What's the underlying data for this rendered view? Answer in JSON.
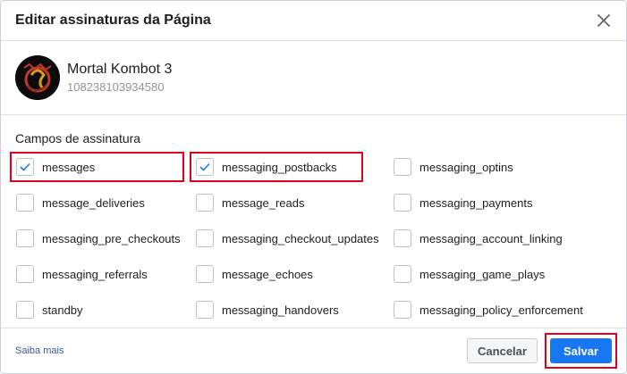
{
  "dialog": {
    "title": "Editar assinaturas da Página"
  },
  "page": {
    "name": "Mortal Kombot 3",
    "id": "108238103934580"
  },
  "subscription_fields": {
    "label": "Campos de assinatura",
    "items": [
      {
        "label": "messages",
        "checked": true,
        "highlighted": true
      },
      {
        "label": "messaging_postbacks",
        "checked": true,
        "highlighted": true
      },
      {
        "label": "messaging_optins",
        "checked": false,
        "highlighted": false
      },
      {
        "label": "message_deliveries",
        "checked": false,
        "highlighted": false
      },
      {
        "label": "message_reads",
        "checked": false,
        "highlighted": false
      },
      {
        "label": "messaging_payments",
        "checked": false,
        "highlighted": false
      },
      {
        "label": "messaging_pre_checkouts",
        "checked": false,
        "highlighted": false
      },
      {
        "label": "messaging_checkout_updates",
        "checked": false,
        "highlighted": false
      },
      {
        "label": "messaging_account_linking",
        "checked": false,
        "highlighted": false
      },
      {
        "label": "messaging_referrals",
        "checked": false,
        "highlighted": false
      },
      {
        "label": "message_echoes",
        "checked": false,
        "highlighted": false
      },
      {
        "label": "messaging_game_plays",
        "checked": false,
        "highlighted": false
      },
      {
        "label": "standby",
        "checked": false,
        "highlighted": false
      },
      {
        "label": "messaging_handovers",
        "checked": false,
        "highlighted": false
      },
      {
        "label": "messaging_policy_enforcement",
        "checked": false,
        "highlighted": false
      }
    ]
  },
  "footer": {
    "learn_more": "Saiba mais",
    "cancel_label": "Cancelar",
    "save_label": "Salvar",
    "save_highlighted": true
  },
  "colors": {
    "primary": "#1877f2",
    "highlight": "#e0001b",
    "check": "#1877f2"
  },
  "icons": {
    "close": "close-icon",
    "check": "check-icon",
    "avatar": "mortal-kombat-logo"
  }
}
